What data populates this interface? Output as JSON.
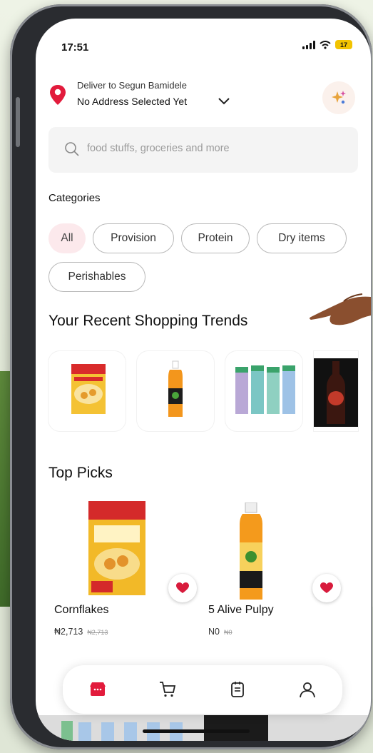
{
  "status_bar": {
    "time": "17:51",
    "battery": "17"
  },
  "delivery": {
    "label": "Deliver to Segun Bamidele",
    "address": "No Address Selected Yet"
  },
  "search": {
    "placeholder": "food stuffs, groceries and more"
  },
  "categories": {
    "title": "Categories",
    "items": [
      {
        "label": "All",
        "active": true
      },
      {
        "label": "Provision",
        "active": false
      },
      {
        "label": "Protein",
        "active": false
      },
      {
        "label": "Dry items",
        "active": false
      },
      {
        "label": "Perishables",
        "active": false
      }
    ]
  },
  "trends": {
    "title": "Your Recent Shopping Trends",
    "items": [
      "cornflakes-box",
      "orange-juice-bottle",
      "air-freshener-cans",
      "dark-malt-bottle"
    ]
  },
  "top_picks": {
    "title": "Top Picks",
    "items": [
      {
        "name": "Cornflakes",
        "price": "₦2,713",
        "old_price": "₦2,713"
      },
      {
        "name": "5 Alive Pulpy",
        "price": "N0",
        "old_price": "₦0"
      }
    ]
  },
  "bottom_nav": {
    "items": [
      "store-icon",
      "cart-icon",
      "orders-icon",
      "profile-icon"
    ]
  },
  "colors": {
    "accent": "#e21b3c",
    "chip_active_bg": "#fce9ec"
  }
}
